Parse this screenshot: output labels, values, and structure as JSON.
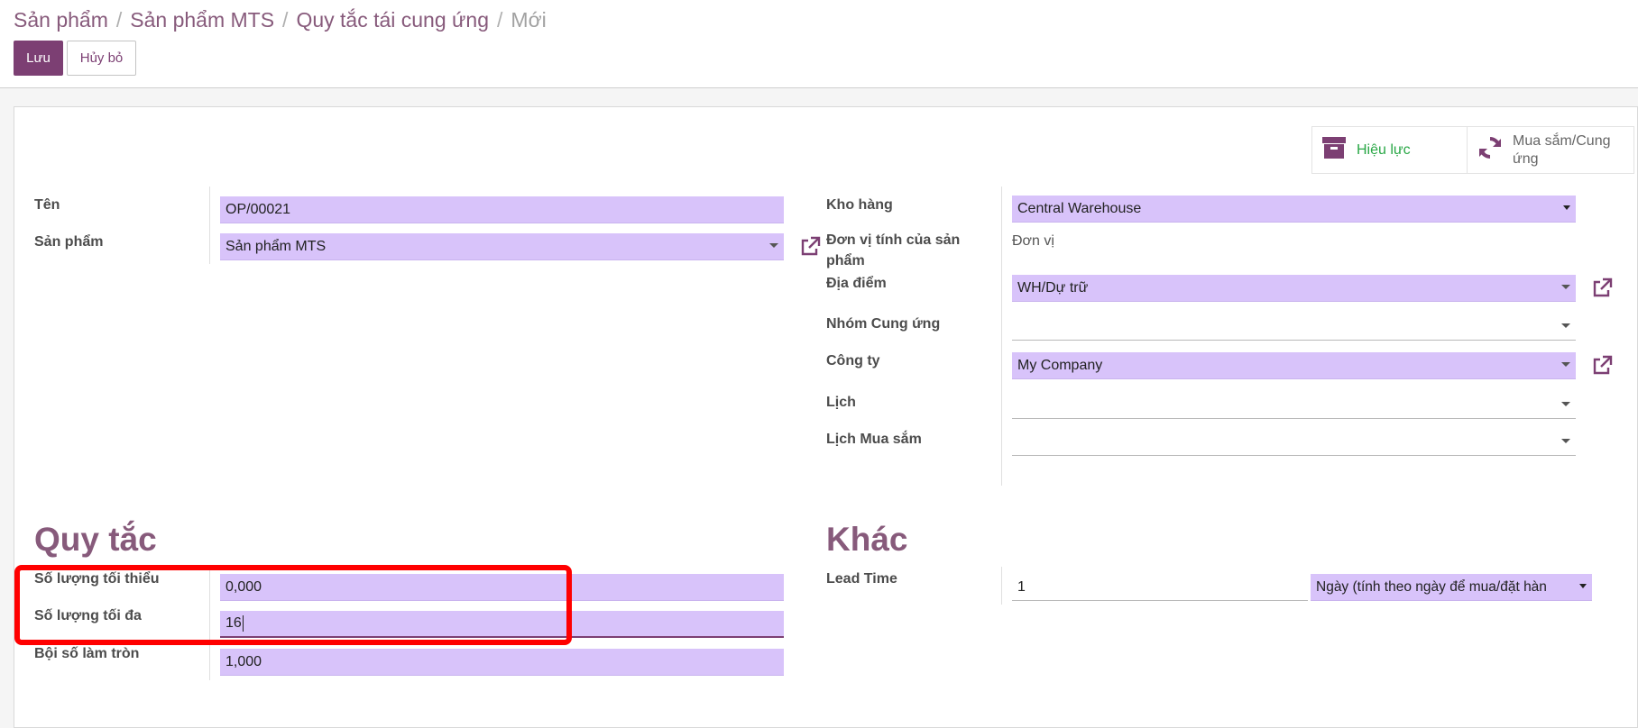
{
  "breadcrumb": {
    "items": [
      "Sản phẩm",
      "Sản phẩm MTS",
      "Quy tắc tái cung ứng"
    ],
    "current": "Mới",
    "separator": "/"
  },
  "buttons": {
    "save": "Lưu",
    "discard": "Hủy bỏ"
  },
  "smart_buttons": {
    "active": "Hiệu lực",
    "procurement": "Mua sắm/Cung ứng"
  },
  "left_fields": {
    "name_label": "Tên",
    "name_value": "OP/00021",
    "product_label": "Sản phẩm",
    "product_value": "Sản phẩm MTS"
  },
  "right_fields": {
    "warehouse_label": "Kho hàng",
    "warehouse_value": "Central Warehouse",
    "uom_label": "Đơn vị tính của sản phẩm",
    "uom_value": "Đơn vị",
    "location_label": "Địa điểm",
    "location_value": "WH/Dự trữ",
    "group_label": "Nhóm Cung ứng",
    "group_value": "",
    "company_label": "Công ty",
    "company_value": "My Company",
    "calendar_label": "Lịch",
    "calendar_value": "",
    "purchase_calendar_label": "Lịch Mua sắm",
    "purchase_calendar_value": ""
  },
  "rules": {
    "title": "Quy tắc",
    "min_qty_label": "Số lượng tối thiểu",
    "min_qty_value": "0,000",
    "max_qty_label": "Số lượng tối đa",
    "max_qty_value": "16",
    "multiple_label": "Bội số làm tròn",
    "multiple_value": "1,000"
  },
  "other": {
    "title": "Khác",
    "lead_time_label": "Lead Time",
    "lead_time_value": "1",
    "lead_type_value": "Ngày (tính theo ngày để mua/đặt hàn"
  },
  "colors": {
    "brand": "#875a7b",
    "save_button": "#7c3f73",
    "field_required": "#d8c3fa",
    "active_green": "#28a745",
    "highlight": "#ff0000"
  },
  "icons": {
    "archive": "archive-icon",
    "refresh": "refresh-icon",
    "external_link": "external-link-icon",
    "dropdown": "caret-down-icon"
  }
}
